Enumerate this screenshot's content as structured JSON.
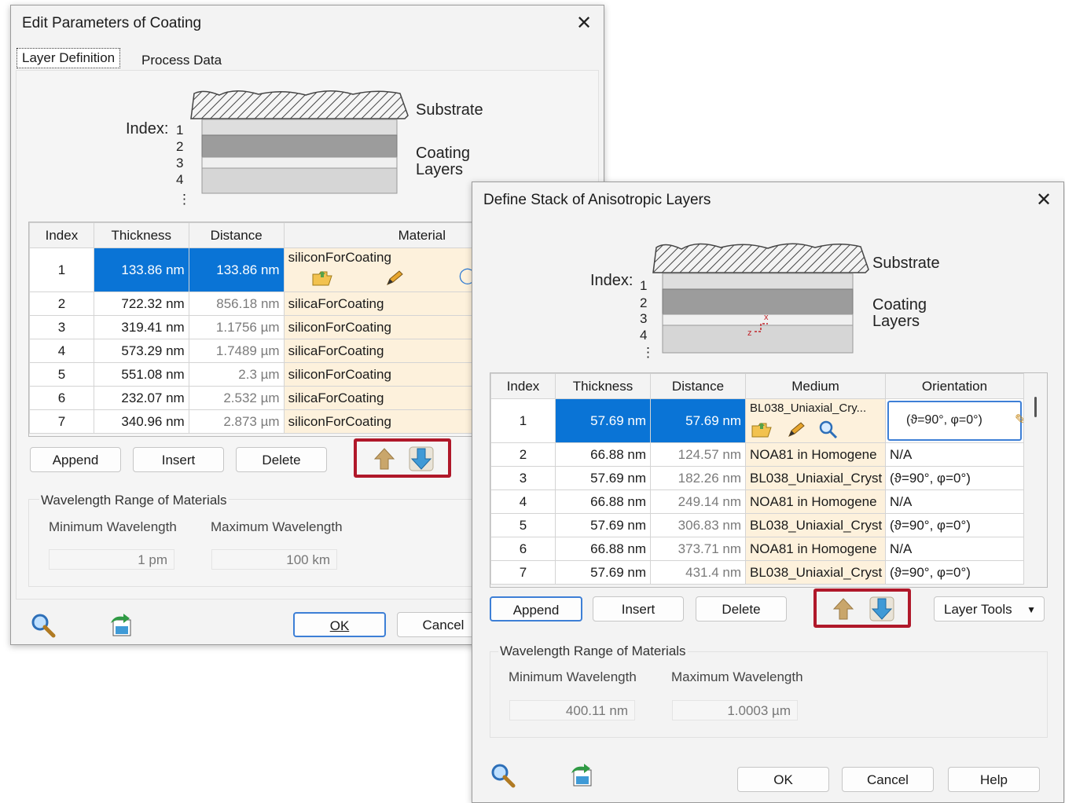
{
  "dialog1": {
    "title": "Edit Parameters of Coating",
    "tabs": [
      "Layer Definition",
      "Process Data"
    ],
    "stack": {
      "index_label": "Index:",
      "indices": [
        "1",
        "2",
        "3",
        "4",
        "⋮"
      ],
      "substrate_label": "Substrate",
      "coating_label_1": "Coating",
      "coating_label_2": "Layers"
    },
    "table": {
      "headers": [
        "Index",
        "Thickness",
        "Distance",
        "Material"
      ],
      "rows": [
        {
          "index": "1",
          "thickness": "133.86 nm",
          "distance": "133.86 nm",
          "material": "siliconForCoating"
        },
        {
          "index": "2",
          "thickness": "722.32 nm",
          "distance": "856.18 nm",
          "material": "silicaForCoating"
        },
        {
          "index": "3",
          "thickness": "319.41 nm",
          "distance": "1.1756 µm",
          "material": "siliconForCoating"
        },
        {
          "index": "4",
          "thickness": "573.29 nm",
          "distance": "1.7489 µm",
          "material": "silicaForCoating"
        },
        {
          "index": "5",
          "thickness": "551.08 nm",
          "distance": "2.3 µm",
          "material": "siliconForCoating"
        },
        {
          "index": "6",
          "thickness": "232.07 nm",
          "distance": "2.532 µm",
          "material": "silicaForCoating"
        },
        {
          "index": "7",
          "thickness": "340.96 nm",
          "distance": "2.873 µm",
          "material": "siliconForCoating"
        }
      ]
    },
    "buttons": {
      "append": "Append",
      "insert": "Insert",
      "delete": "Delete",
      "ok": "OK",
      "cancel": "Cancel"
    },
    "wavelength": {
      "group_label": "Wavelength Range of Materials",
      "min_label": "Minimum Wavelength",
      "max_label": "Maximum Wavelength",
      "min_value": "1 pm",
      "max_value": "100 km"
    }
  },
  "dialog2": {
    "title": "Define Stack of Anisotropic Layers",
    "stack": {
      "index_label": "Index:",
      "indices": [
        "1",
        "2",
        "3",
        "4",
        "⋮"
      ],
      "substrate_label": "Substrate",
      "coating_label_1": "Coating",
      "coating_label_2": "Layers",
      "axis_x": "x",
      "axis_z": "z"
    },
    "table": {
      "headers": [
        "Index",
        "Thickness",
        "Distance",
        "Medium",
        "Orientation"
      ],
      "rows": [
        {
          "index": "1",
          "thickness": "57.69 nm",
          "distance": "57.69 nm",
          "medium": "BL038_Uniaxial_Cry...",
          "orientation": "(ϑ=90°, φ=0°)"
        },
        {
          "index": "2",
          "thickness": "66.88 nm",
          "distance": "124.57 nm",
          "medium": "NOA81 in Homogene",
          "orientation": "N/A"
        },
        {
          "index": "3",
          "thickness": "57.69 nm",
          "distance": "182.26 nm",
          "medium": "BL038_Uniaxial_Cryst",
          "orientation": "(ϑ=90°, φ=0°)"
        },
        {
          "index": "4",
          "thickness": "66.88 nm",
          "distance": "249.14 nm",
          "medium": "NOA81 in Homogene",
          "orientation": "N/A"
        },
        {
          "index": "5",
          "thickness": "57.69 nm",
          "distance": "306.83 nm",
          "medium": "BL038_Uniaxial_Cryst",
          "orientation": "(ϑ=90°, φ=0°)"
        },
        {
          "index": "6",
          "thickness": "66.88 nm",
          "distance": "373.71 nm",
          "medium": "NOA81 in Homogene",
          "orientation": "N/A"
        },
        {
          "index": "7",
          "thickness": "57.69 nm",
          "distance": "431.4 nm",
          "medium": "BL038_Uniaxial_Cryst",
          "orientation": "(ϑ=90°, φ=0°)"
        }
      ]
    },
    "buttons": {
      "append": "Append",
      "insert": "Insert",
      "delete": "Delete",
      "layer_tools": "Layer Tools",
      "ok": "OK",
      "cancel": "Cancel",
      "help": "Help"
    },
    "wavelength": {
      "group_label": "Wavelength Range of Materials",
      "min_label": "Minimum Wavelength",
      "max_label": "Maximum Wavelength",
      "min_value": "400.11 nm",
      "max_value": "1.0003 µm"
    }
  },
  "colors": {
    "selection": "#0a74d6",
    "material_cell": "#fdf1dc",
    "highlight_box": "#b0182a",
    "up_arrow": "#c9a66b",
    "down_arrow": "#3f9ad6"
  }
}
